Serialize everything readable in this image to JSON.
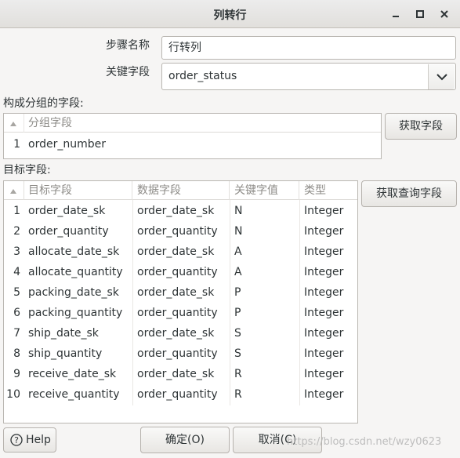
{
  "window": {
    "title": "列转行"
  },
  "form": {
    "step_name_label": "步骤名称",
    "step_name_value": "行转列",
    "key_field_label": "关键字段",
    "key_field_value": "order_status"
  },
  "group_section": {
    "label": "构成分组的字段:",
    "columns": [
      "分组字段"
    ],
    "rows": [
      {
        "num": "1",
        "field": "order_number"
      }
    ],
    "get_fields_button": "获取字段"
  },
  "target_section": {
    "label": "目标字段:",
    "columns": [
      "目标字段",
      "数据字段",
      "关键字值",
      "类型"
    ],
    "rows": [
      {
        "num": "1",
        "target": "order_date_sk",
        "data": "order_date_sk",
        "key": "N",
        "type": "Integer"
      },
      {
        "num": "2",
        "target": "order_quantity",
        "data": "order_quantity",
        "key": "N",
        "type": "Integer"
      },
      {
        "num": "3",
        "target": "allocate_date_sk",
        "data": "order_date_sk",
        "key": "A",
        "type": "Integer"
      },
      {
        "num": "4",
        "target": "allocate_quantity",
        "data": "order_quantity",
        "key": "A",
        "type": "Integer"
      },
      {
        "num": "5",
        "target": "packing_date_sk",
        "data": "order_date_sk",
        "key": "P",
        "type": "Integer"
      },
      {
        "num": "6",
        "target": "packing_quantity",
        "data": "order_quantity",
        "key": "P",
        "type": "Integer"
      },
      {
        "num": "7",
        "target": "ship_date_sk",
        "data": "order_date_sk",
        "key": "S",
        "type": "Integer"
      },
      {
        "num": "8",
        "target": "ship_quantity",
        "data": "order_quantity",
        "key": "S",
        "type": "Integer"
      },
      {
        "num": "9",
        "target": "receive_date_sk",
        "data": "order_date_sk",
        "key": "R",
        "type": "Integer"
      },
      {
        "num": "10",
        "target": "receive_quantity",
        "data": "order_quantity",
        "key": "R",
        "type": "Integer"
      }
    ],
    "get_lookup_fields_button": "获取查询字段"
  },
  "footer": {
    "help_button": "Help",
    "ok_button": "确定(O)",
    "cancel_button": "取消(C)",
    "watermark": "https://blog.csdn.net/wzy0623"
  }
}
